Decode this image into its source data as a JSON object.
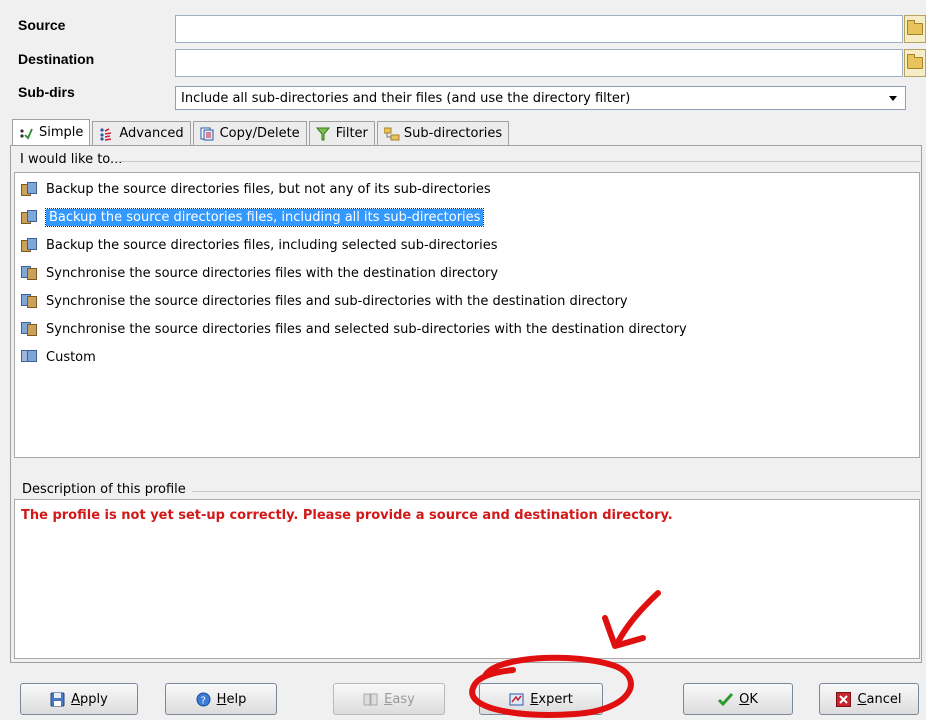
{
  "form": {
    "source_label": "Source",
    "destination_label": "Destination",
    "subdirs_label": "Sub-dirs",
    "source_value": "",
    "destination_value": "",
    "subdirs_value": "Include all sub-directories and their files (and use the directory filter)"
  },
  "tabs": [
    {
      "label": "Simple",
      "icon": "simple-icon",
      "active": true
    },
    {
      "label": "Advanced",
      "icon": "advanced-icon",
      "active": false
    },
    {
      "label": "Copy/Delete",
      "icon": "copy-delete-icon",
      "active": false
    },
    {
      "label": "Filter",
      "icon": "filter-icon",
      "active": false
    },
    {
      "label": "Sub-directories",
      "icon": "sub-directories-icon",
      "active": false
    }
  ],
  "options_group": {
    "title": "I would like to...",
    "items": [
      "Backup the source directories files, but not any of its sub-directories",
      "Backup the source directories files, including all its sub-directories",
      "Backup the source directories files, including selected sub-directories",
      "Synchronise the source directories files with the destination directory",
      "Synchronise the source directories files and sub-directories with the destination directory",
      "Synchronise the source directories files and selected sub-directories with the destination directory",
      "Custom"
    ],
    "selected_index": 1
  },
  "description": {
    "title": "Description of this profile",
    "text": "The profile is not yet set-up correctly. Please provide a source and destination directory."
  },
  "buttons": {
    "apply_accel": "A",
    "apply_rest": "pply",
    "help_accel": "H",
    "help_rest": "elp",
    "easy_accel": "E",
    "easy_rest": "asy",
    "expert_accel": "E",
    "expert_rest": "xpert",
    "ok_accel": "O",
    "ok_rest": "K",
    "cancel_accel": "C",
    "cancel_rest": "ancel"
  },
  "annotation_color": "#e01010"
}
